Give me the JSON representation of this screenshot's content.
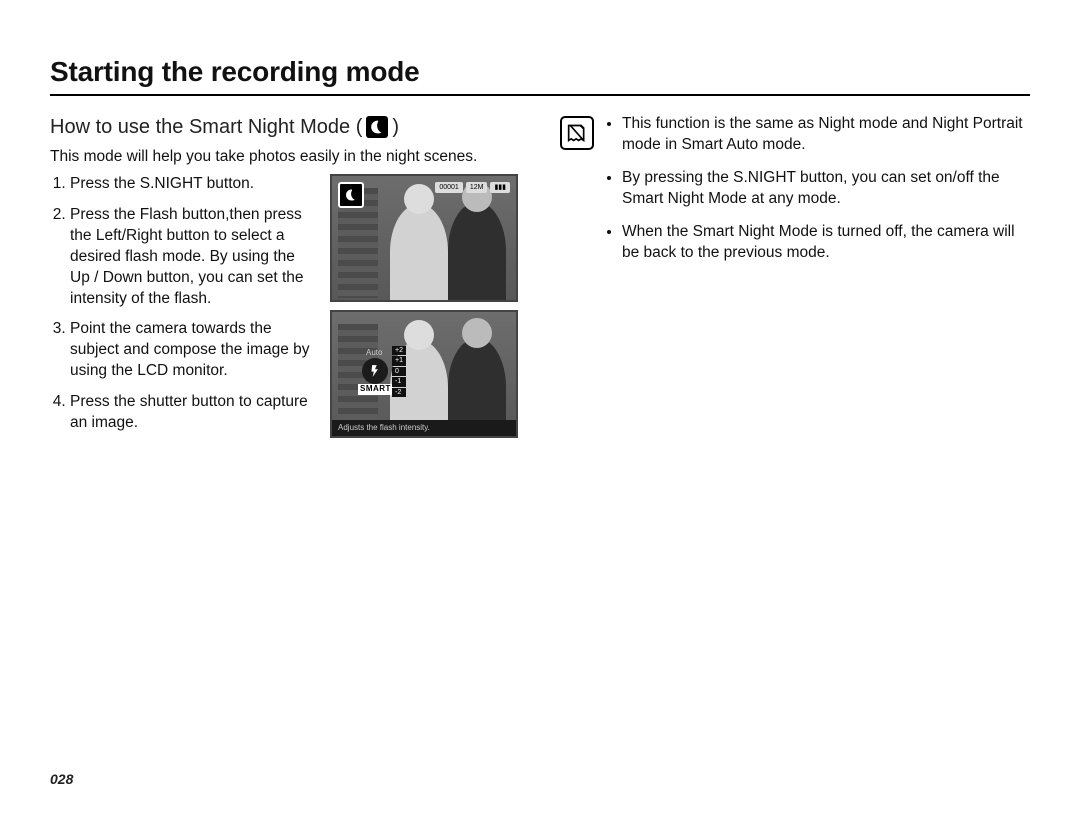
{
  "header": {
    "title": "Starting the recording mode"
  },
  "left": {
    "section_title_prefix": "How to use the Smart Night Mode ( ",
    "section_title_suffix": " )",
    "intro": "This mode will help you take photos easily in the night scenes.",
    "steps": [
      "Press the S.NIGHT button.",
      "Press the Flash button,then press the Left/Right button to select a desired flash mode. By using the Up / Down button, you can set the intensity of the flash.",
      "Point the camera towards the subject and compose the image by using the LCD monitor.",
      "Press the shutter button to capture an image."
    ],
    "lcd_top": {
      "topright": [
        "00001",
        "12M"
      ],
      "battery": "▮▮▮"
    },
    "lcd_bottom": {
      "auto_label": "Auto",
      "smart_label": "SMART",
      "intensity_levels": [
        "+2",
        "+1",
        "0",
        "-1",
        "-2"
      ],
      "hint": "Adjusts the flash intensity."
    }
  },
  "right": {
    "notes": [
      "This function is the same as Night mode and Night Portrait mode in Smart Auto mode.",
      "By pressing the S.NIGHT button, you can set on/off the Smart Night Mode at any mode.",
      "When the Smart Night Mode is turned off, the camera will be back to the previous mode."
    ]
  },
  "page_number": "028"
}
